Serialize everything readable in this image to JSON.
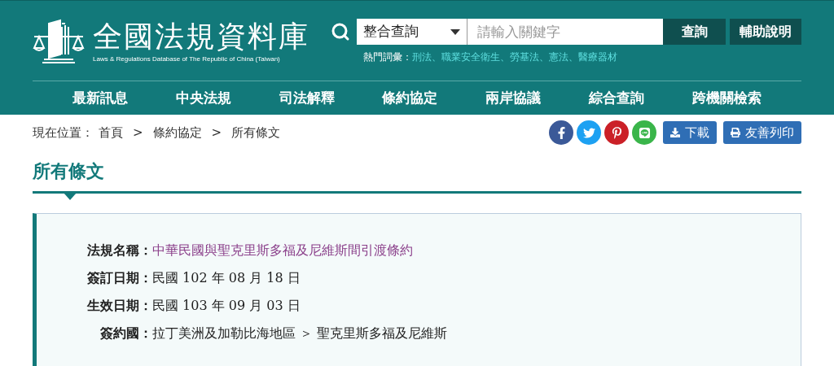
{
  "header": {
    "title": "全國法規資料庫",
    "subtitle": "Laws & Regulations Database of The Republic of China (Taiwan)"
  },
  "search": {
    "scope": "整合查詢",
    "placeholder": "請輸入關鍵字",
    "buttons": [
      "查詢",
      "輔助說明"
    ]
  },
  "hot_words": {
    "label": "熱門詞彙：",
    "separator": "、",
    "items": [
      "刑法",
      "職業安全衛生",
      "勞基法",
      "憲法",
      "醫療器材"
    ]
  },
  "nav": [
    "最新訊息",
    "中央法規",
    "司法解釋",
    "條約協定",
    "兩岸協議",
    "綜合查詢",
    "跨機關檢索"
  ],
  "breadcrumb": {
    "label": "現在位置：",
    "separator": ">",
    "items": [
      "首頁",
      "條約協定",
      "所有條文"
    ]
  },
  "share": [
    {
      "kind": "facebook",
      "color": "#3b5998"
    },
    {
      "kind": "twitter",
      "color": "#1da1f2"
    },
    {
      "kind": "pinterest",
      "color": "#cb2027"
    },
    {
      "kind": "line",
      "color": "#3ab54a"
    }
  ],
  "actions": [
    {
      "kind": "download",
      "label": "下載"
    },
    {
      "kind": "print",
      "label": "友善列印"
    }
  ],
  "page_title": "所有條文",
  "fields": [
    {
      "label": "法規名稱：",
      "value": "中華民國與聖克里斯多福及尼維斯間引渡條約",
      "kind": "link"
    },
    {
      "label": "簽訂日期：",
      "value": "民國 102 年 08 月 18 日",
      "kind": "plain"
    },
    {
      "label": "生效日期：",
      "value": "民國 103 年 09 月 03 日",
      "kind": "plain"
    },
    {
      "label": "簽約國：",
      "value": "拉丁美洲及加勒比海地區 ＞ 聖克里斯多福及尼維斯",
      "kind": "plain"
    }
  ]
}
